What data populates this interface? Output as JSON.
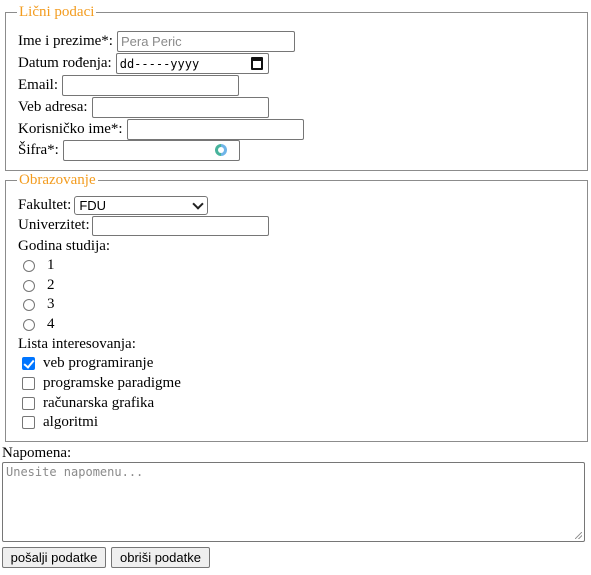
{
  "personal": {
    "legend": "Lični podaci",
    "full_name": {
      "label": "Ime i prezime*:",
      "placeholder": "Pera Peric"
    },
    "birth_date": {
      "label": "Datum rođenja:",
      "value": "dd-----yyyy"
    },
    "email": {
      "label": "Email:",
      "value": ""
    },
    "website": {
      "label": "Veb adresa:",
      "value": ""
    },
    "username": {
      "label": "Korisničko ime*:",
      "value": ""
    },
    "password": {
      "label": "Šifra*:",
      "value": ""
    }
  },
  "education": {
    "legend": "Obrazovanje",
    "faculty": {
      "label": "Fakultet:",
      "selected": "FDU"
    },
    "university": {
      "label": "Univerzitet:",
      "value": ""
    },
    "year": {
      "label": "Godina studija:",
      "options": [
        "1",
        "2",
        "3",
        "4"
      ]
    },
    "interests": {
      "label": "Lista interesovanja:",
      "options": [
        {
          "label": "veb programiranje",
          "checked": true
        },
        {
          "label": "programske paradigme",
          "checked": false
        },
        {
          "label": "računarska grafika",
          "checked": false
        },
        {
          "label": "algoritmi",
          "checked": false
        }
      ]
    }
  },
  "note": {
    "label": "Napomena:",
    "placeholder": "Unesite napomenu..."
  },
  "actions": {
    "submit": "pošalji podatke",
    "reset": "obriši podatke"
  },
  "colors": {
    "legend": "#f39c1f",
    "checkbox_checked": "#0075ff"
  }
}
